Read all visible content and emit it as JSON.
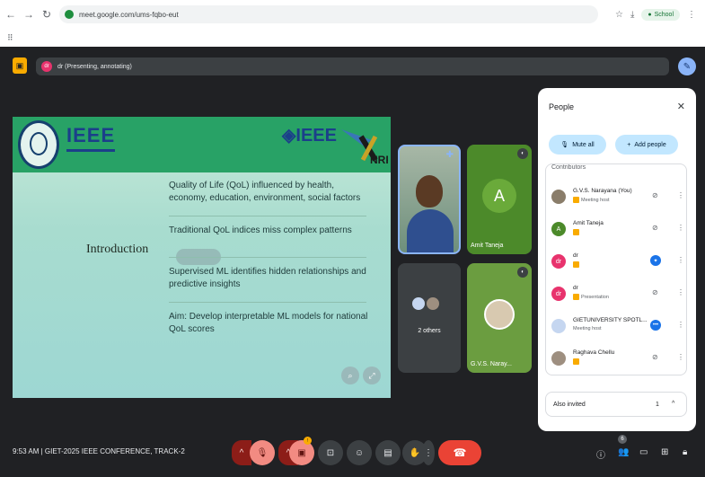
{
  "browser": {
    "url": "meet.google.com/ums-fqbo-eut",
    "profile_label": "School"
  },
  "meet": {
    "presenting_text": "dr (Presenting, annotating)",
    "presenter_initial": "dr"
  },
  "slide": {
    "ieee_left": "IEEE",
    "ieee_right": "IEEE",
    "title": "Introduction",
    "bullets": [
      "Quality of Life (QoL) influenced by health, economy, education, environment, social factors",
      "Traditional QoL indices miss complex patterns",
      "Supervised ML identifies hidden relationships and predictive insights",
      "Aim: Develop interpretable ML models for national QoL scores"
    ],
    "nrf_label": "NRF"
  },
  "tiles": {
    "amit": {
      "initial": "A",
      "name": "Amit Taneja"
    },
    "others": {
      "label": "2 others"
    },
    "gvs": {
      "name": "G.V.S. Naray..."
    }
  },
  "people": {
    "title": "People",
    "close": "✕",
    "mute_all": "Mute all",
    "add_people": "Add people",
    "section_header": "Contributors",
    "rows": [
      {
        "name": "G.V.S. Narayana (You)",
        "sub": "Meeting host",
        "avatar": "",
        "color": "#8a7d6a"
      },
      {
        "name": "Amit Taneja",
        "sub": "",
        "avatar": "A",
        "color": "#4c8a2a"
      },
      {
        "name": "dr",
        "sub": "",
        "avatar": "dr",
        "color": "#e8336d"
      },
      {
        "name": "dr",
        "sub": "Presentation",
        "avatar": "dr",
        "color": "#e8336d"
      },
      {
        "name": "GIETUNIVERSITY SPOTL...",
        "sub": "Meeting host",
        "avatar": "",
        "color": "#c5d6f0"
      },
      {
        "name": "Raghava Chellu",
        "sub": "",
        "avatar": "",
        "color": "#9e8f80"
      }
    ],
    "also_invited": "Also invited",
    "also_count": "1"
  },
  "bottom": {
    "time_text": "9:53 AM  |  GIET-2025 IEEE CONFERENCE, TRACK-2",
    "people_count": "6",
    "reaction_count": "!"
  },
  "colors": {
    "meet_bg": "#202124",
    "slide_green": "#28a266",
    "end_call": "#ea4335",
    "accent_blue": "#8ab4f8"
  }
}
